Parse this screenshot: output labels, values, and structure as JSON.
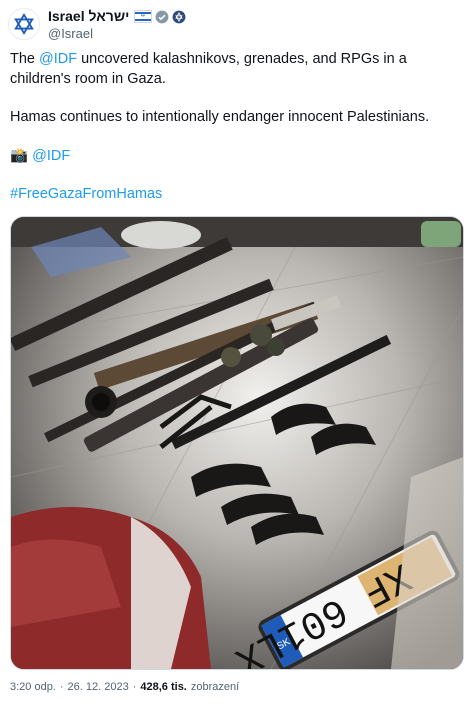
{
  "account": {
    "name": "Israel ישראל",
    "handle": "@Israel",
    "verified_color": "#8899a6",
    "accent": "#1d9bf0"
  },
  "tweet": {
    "mention": "@IDF",
    "text_1": " uncovered kalashnikovs, grenades, and RPGs in a children's room in Gaza.",
    "text_2": "Hamas continues to intentionally endanger innocent Palestinians.",
    "camera_emoji": "📸",
    "credit": "@IDF",
    "hashtag": "#FreeGazaFromHamas"
  },
  "media": {
    "plate_text": "XF 601LX",
    "plate_country": "SK"
  },
  "meta": {
    "time": "3:20 odp.",
    "date": "26. 12. 2023",
    "views_count": "428,6 tis.",
    "views_label": "zobrazení"
  }
}
